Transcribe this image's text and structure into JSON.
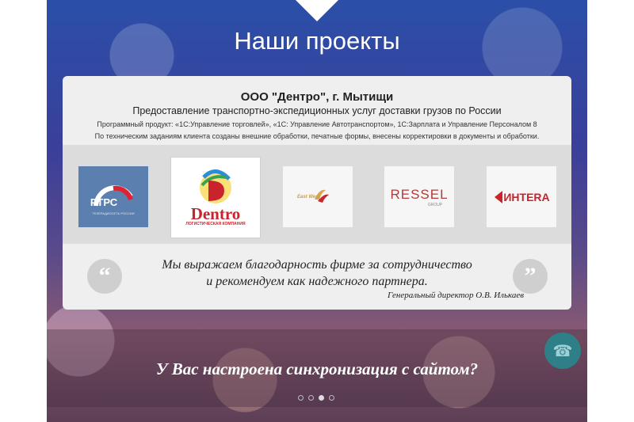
{
  "section": {
    "title": "Наши проекты"
  },
  "project": {
    "company": "ООО \"Дентро\", г. Мытищи",
    "subtitle": "Предоставление транспортно-экспедиционных услуг доставки грузов по России",
    "line1": "Программный продукт: «1С:Управление торговлей», «1С: Управление Автотранспортом», 1С:Зарплата и Управление Персоналом 8",
    "line2": "По техническим заданиям клиента созданы внешние обработки, печатные формы, внесены корректировки в документы и обработки."
  },
  "logos": [
    {
      "name": "РТРС",
      "sub": "ТЕЛЕРАДИОСЕТЬ РОССИИ"
    },
    {
      "name": "Dentro",
      "sub": "ЛОГИСТИЧЕСКАЯ КОМПАНИЯ"
    },
    {
      "name": "East West",
      "sub": ""
    },
    {
      "name": "RESSEL",
      "sub": "GROUP"
    },
    {
      "name": "ИНТЕRA",
      "sub": ""
    }
  ],
  "testimonial": {
    "line1": "Мы выражаем благодарность фирме за сотрудничество",
    "line2": "и рекомендуем как надежного партнера.",
    "author": "Генеральный директор О.В. Илькаев"
  },
  "banner": {
    "text": "У Вас настроена синхронизация с сайтом?"
  },
  "icons": {
    "quote_open": "quote-open-icon",
    "quote_close": "quote-close-icon",
    "phone": "phone-icon"
  },
  "carousel": {
    "dot_count": 4,
    "active_index": 2
  }
}
